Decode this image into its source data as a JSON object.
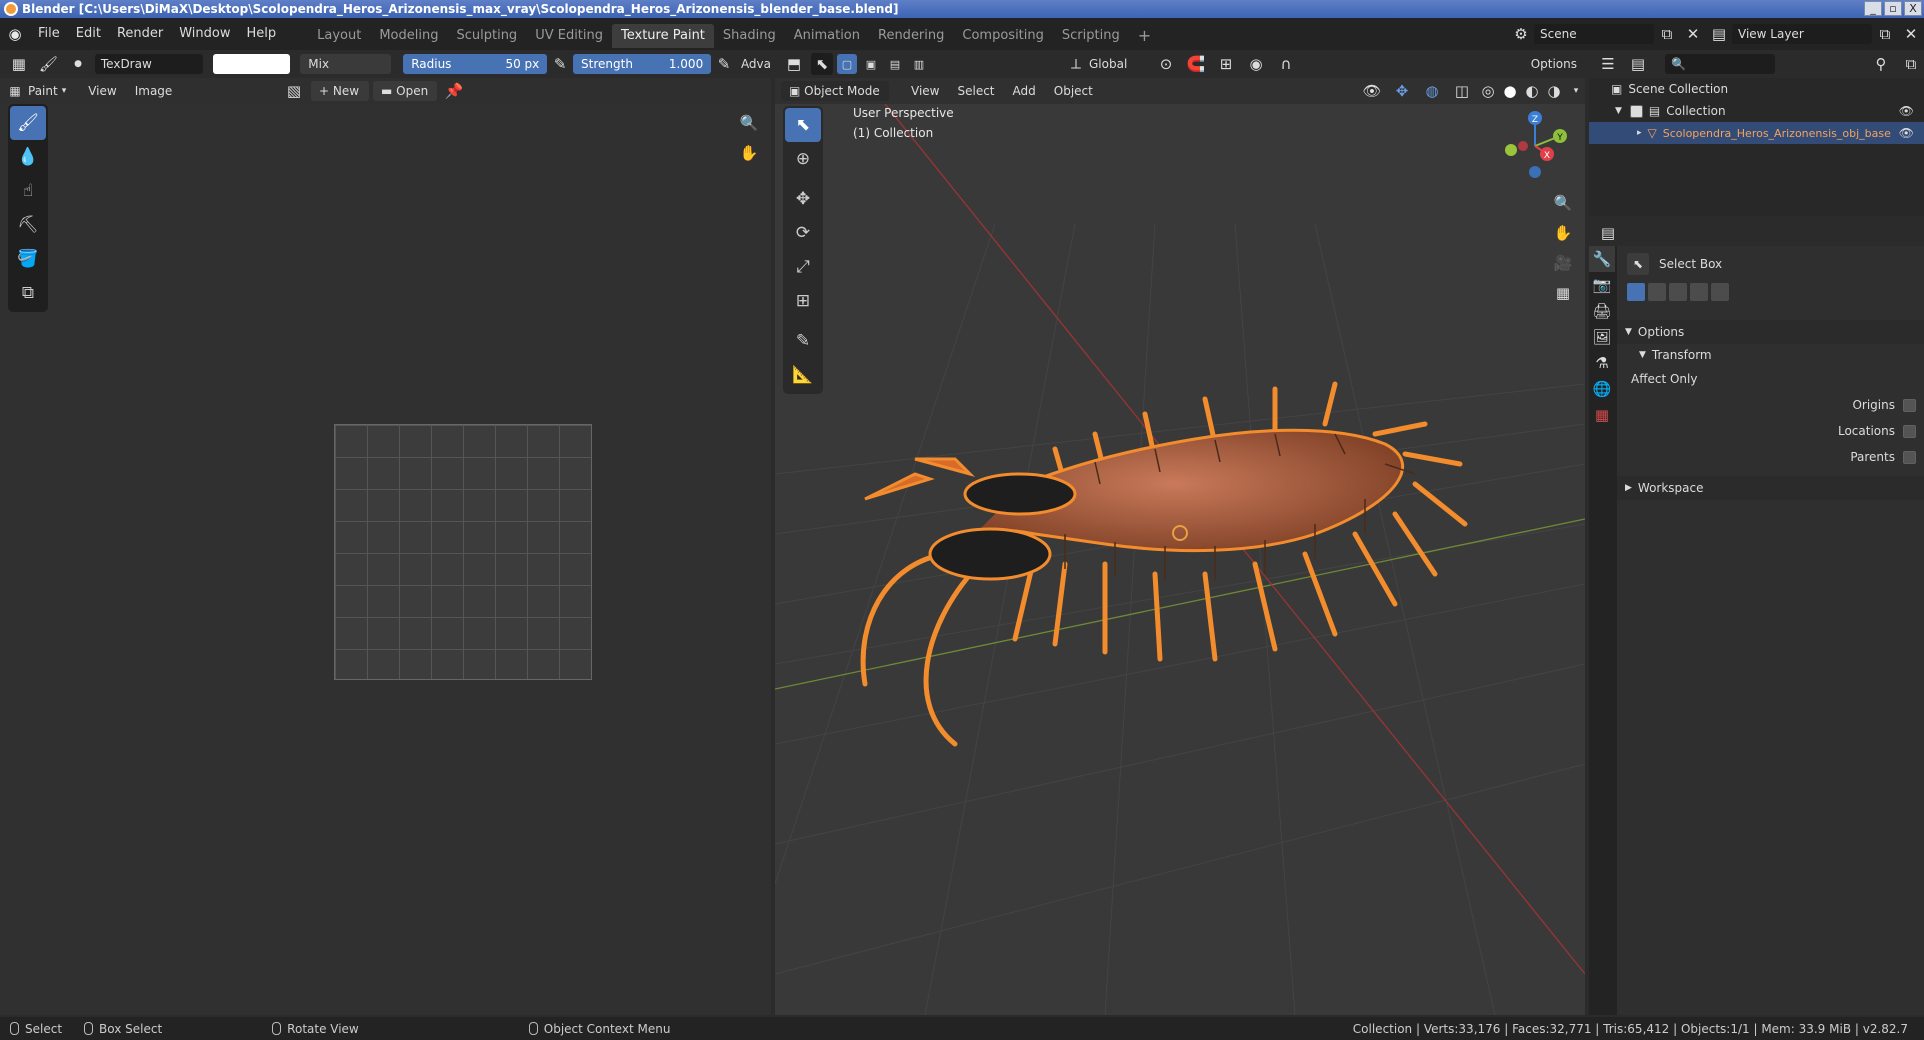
{
  "window": {
    "title": "Blender [C:\\Users\\DiMaX\\Desktop\\Scolopendra_Heros_Arizonensis_max_vray\\Scolopendra_Heros_Arizonensis_blender_base.blend]",
    "min": "_",
    "max": "▫",
    "close": "X"
  },
  "menu": [
    "File",
    "Edit",
    "Render",
    "Window",
    "Help"
  ],
  "workspaces": [
    "Layout",
    "Modeling",
    "Sculpting",
    "UV Editing",
    "Texture Paint",
    "Shading",
    "Animation",
    "Rendering",
    "Compositing",
    "Scripting"
  ],
  "active_workspace": "Texture Paint",
  "scene": {
    "label": "Scene",
    "viewlayer": "View Layer"
  },
  "image_editor": {
    "brush_name": "TexDraw",
    "blend_mode": "Mix",
    "radius_label": "Radius",
    "radius_value": "50 px",
    "strength_label": "Strength",
    "strength_value": "1.000",
    "adv_label": "Adva",
    "mode": "Paint",
    "view": "View",
    "image": "Image",
    "new": "New",
    "open": "Open"
  },
  "viewport": {
    "orientation": "Global",
    "options": "Options",
    "mode": "Object Mode",
    "menus": [
      "View",
      "Select",
      "Add",
      "Object"
    ],
    "perspective": "User Perspective",
    "collection": "(1) Collection",
    "gizmo": {
      "x": "X",
      "y": "Y",
      "z": "Z"
    }
  },
  "outliner": {
    "scene_collection": "Scene Collection",
    "collection": "Collection",
    "object": "Scolopendra_Heros_Arizonensis_obj_base"
  },
  "properties": {
    "tool": "Select Box",
    "options": "Options",
    "transform": "Transform",
    "affect_only": "Affect Only",
    "origins": "Origins",
    "locations": "Locations",
    "parents": "Parents",
    "workspace": "Workspace"
  },
  "statusbar": {
    "select": "Select",
    "box_select": "Box Select",
    "rotate": "Rotate View",
    "context": "Object Context Menu",
    "stats": "Collection | Verts:33,176 | Faces:32,771 | Tris:65,412 | Objects:1/1 | Mem: 33.9 MiB | v2.82.7"
  },
  "colors": {
    "accent": "#4772b3",
    "selected_object": "#f5a35b",
    "outline": "#f28c2c"
  }
}
